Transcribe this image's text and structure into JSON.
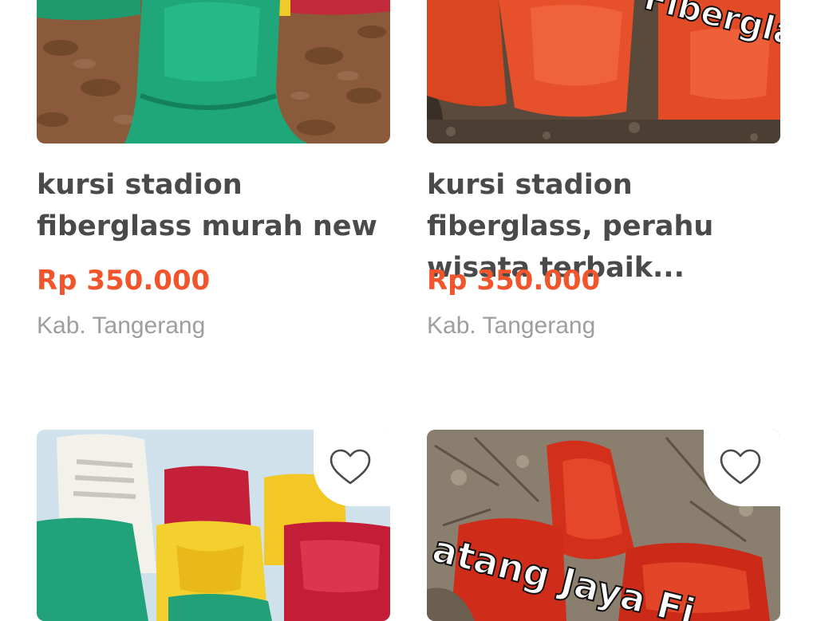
{
  "products": [
    {
      "title": "kursi stadion fiberglass murah new",
      "price": "Rp 350.000",
      "location": "Kab. Tangerang"
    },
    {
      "title": "kursi stadion fiberglass, perahu wisata terbaik...",
      "price": "Rp 350.000",
      "location": "Kab. Tangerang",
      "image_text": "Fiberglas"
    },
    {
      "title": "",
      "price": "",
      "location": ""
    },
    {
      "title": "",
      "price": "",
      "location": "",
      "image_text": "atang Jaya Fi"
    }
  ],
  "colors": {
    "price": "#f2552c",
    "title": "#4a4a4a",
    "location": "#9e9e9e"
  },
  "icons": {
    "wishlist": "heart-outline-icon"
  }
}
